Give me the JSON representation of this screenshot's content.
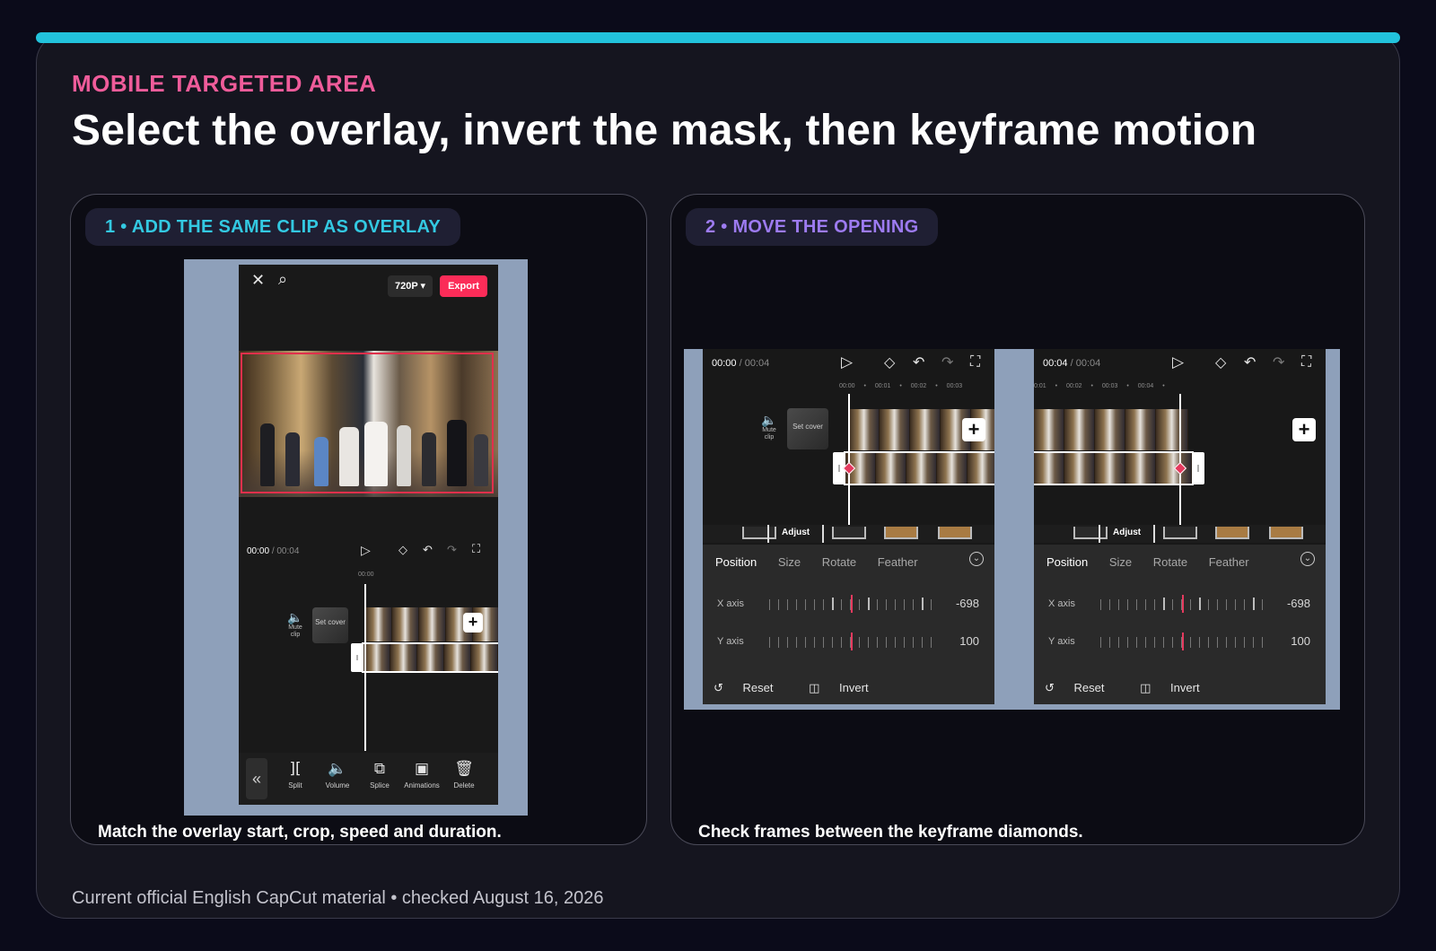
{
  "header": {
    "eyebrow": "MOBILE TARGETED AREA",
    "title": "Select the overlay, invert the mask, then keyframe motion"
  },
  "colors": {
    "accent_bar": "#22c3dc",
    "eyebrow": "#ef5c9a",
    "step1": "#33c9e2",
    "step2": "#9d7bf1",
    "export": "#fb2c58",
    "keyframe": "#e53a5e"
  },
  "step1": {
    "label": "1 • ADD THE SAME CLIP AS OVERLAY",
    "caption": "Match the overlay start, crop, speed and duration.",
    "phone": {
      "close_icon": "close-icon",
      "search_icon": "search-icon",
      "resolution": "720P ▾",
      "export_label": "Export",
      "time_current": "00:00",
      "time_total": "/ 00:04",
      "ruler_time": "00:00",
      "mute_label": "Mute clip",
      "cover_label": "Set cover",
      "tools": [
        {
          "icon": "split-icon",
          "glyph": "][",
          "label": "Split"
        },
        {
          "icon": "volume-icon",
          "glyph": "🔈",
          "label": "Volume"
        },
        {
          "icon": "splice-icon",
          "glyph": "⧉",
          "label": "Splice"
        },
        {
          "icon": "animations-icon",
          "glyph": "▣",
          "label": "Animations"
        },
        {
          "icon": "delete-icon",
          "glyph": "🗑",
          "label": "Delete"
        }
      ],
      "back_glyph": "«"
    }
  },
  "step2": {
    "label": "2 • MOVE THE OPENING",
    "caption": "Check frames between the keyframe diamonds.",
    "screens": [
      {
        "time_current": "00:00",
        "time_total": "/ 00:04",
        "ruler": [
          "00:00",
          "•",
          "00:01",
          "•",
          "00:02",
          "•",
          "00:03"
        ],
        "mute_label": "Mute clip",
        "cover_label": "Set cover",
        "adjust_label": "Adjust",
        "tabs": [
          "Position",
          "Size",
          "Rotate",
          "Feather"
        ],
        "x_label": "X axis",
        "x_value": "-698",
        "y_label": "Y axis",
        "y_value": "100",
        "reset_label": "Reset",
        "invert_label": "Invert"
      },
      {
        "time_current": "00:04",
        "time_total": "/ 00:04",
        "ruler": [
          "0:01",
          "•",
          "00:02",
          "•",
          "00:03",
          "•",
          "00:04",
          "•"
        ],
        "adjust_label": "Adjust",
        "tabs": [
          "Position",
          "Size",
          "Rotate",
          "Feather"
        ],
        "x_label": "X axis",
        "x_value": "-698",
        "y_label": "Y axis",
        "y_value": "100",
        "reset_label": "Reset",
        "invert_label": "Invert"
      }
    ]
  },
  "footer": "Current official English CapCut material • checked August 16, 2026"
}
